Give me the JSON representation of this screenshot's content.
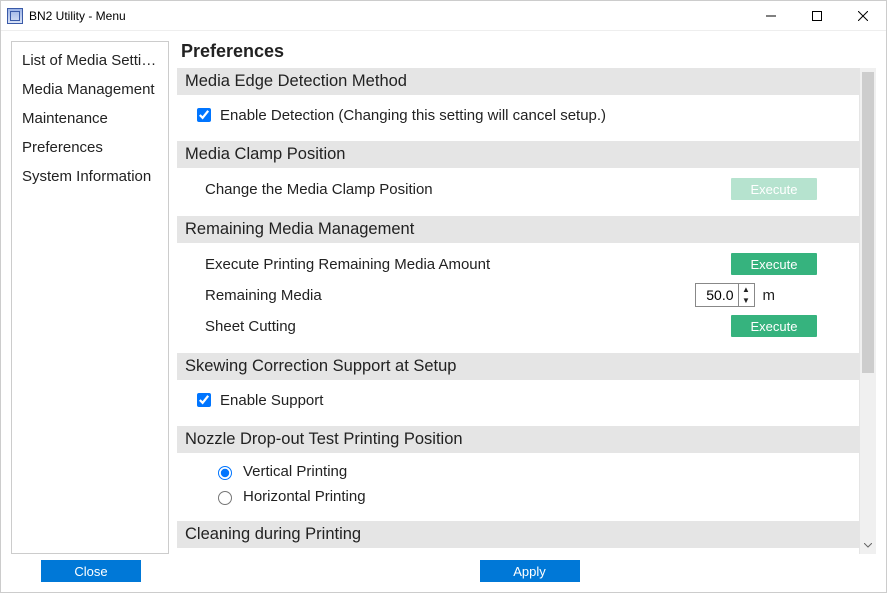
{
  "window": {
    "title": "BN2 Utility - Menu"
  },
  "win_controls": {
    "minimize": "minimize",
    "maximize": "maximize",
    "close": "close"
  },
  "sidebar": {
    "items": [
      {
        "label": "List of Media Settings"
      },
      {
        "label": "Media Management"
      },
      {
        "label": "Maintenance"
      },
      {
        "label": "Preferences"
      },
      {
        "label": "System Information"
      }
    ],
    "close_label": "Close"
  },
  "page": {
    "title": "Preferences",
    "apply_label": "Apply",
    "sections": {
      "edge_detection": {
        "header": "Media Edge Detection Method",
        "checkbox_label": "Enable Detection (Changing this setting will cancel setup.)",
        "checked": true
      },
      "clamp": {
        "header": "Media Clamp Position",
        "change_label": "Change the Media Clamp Position",
        "execute_label": "Execute"
      },
      "remaining": {
        "header": "Remaining Media Management",
        "print_label": "Execute Printing Remaining Media Amount",
        "print_execute_label": "Execute",
        "remaining_label": "Remaining Media",
        "remaining_value": "50.0",
        "remaining_unit": "m",
        "sheet_cut_label": "Sheet Cutting",
        "sheet_cut_execute_label": "Execute"
      },
      "skew": {
        "header": "Skewing Correction Support at Setup",
        "checkbox_label": "Enable Support",
        "checked": true
      },
      "nozzle": {
        "header": "Nozzle Drop-out Test Printing Position",
        "options": [
          {
            "label": "Vertical Printing",
            "checked": true
          },
          {
            "label": "Horizontal Printing",
            "checked": false
          }
        ]
      },
      "cleaning": {
        "header": "Cleaning during Printing"
      }
    }
  }
}
